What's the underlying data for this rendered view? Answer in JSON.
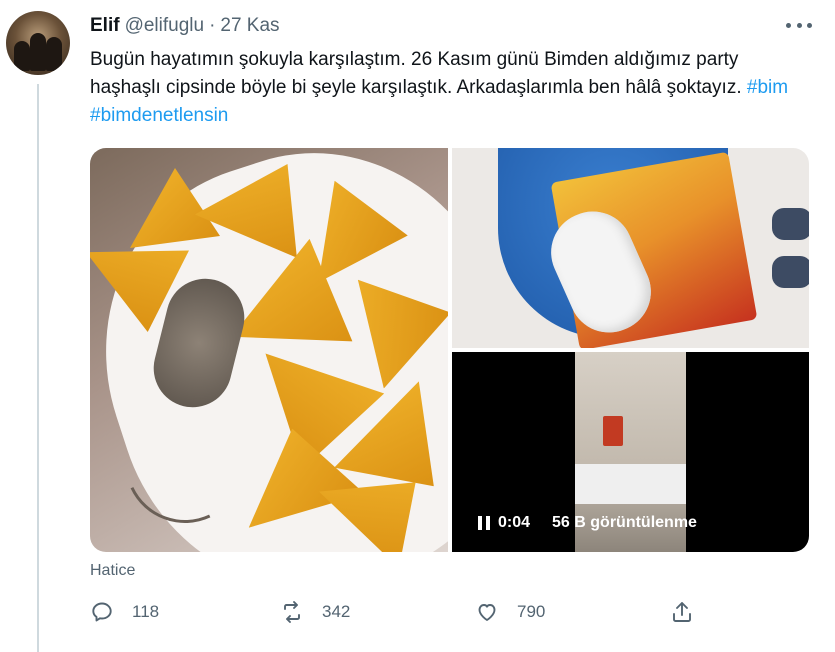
{
  "tweet": {
    "author_name": "Elif",
    "author_handle": "@elifuglu",
    "separator": "·",
    "date": "27 Kas",
    "text": "Bugün hayatımın şokuyla karşılaştım. 26 Kasım günü Bimden aldığımız party haşhaşlı cipsinde böyle bi şeyle karşılaştık. Arkadaşlarımla ben hâlâ şoktayız.",
    "hashtags": [
      "#bim",
      "#bimdenetlensin"
    ]
  },
  "media": {
    "video": {
      "duration": "0:04",
      "views": "56 B görüntülenme"
    }
  },
  "tagged_user": "Hatice",
  "actions": {
    "replies": "118",
    "retweets": "342",
    "likes": "790"
  },
  "icons": [
    "more-icon",
    "reply-icon",
    "retweet-icon",
    "like-icon",
    "share-icon",
    "pause-icon"
  ],
  "colors": {
    "text": "#0f1419",
    "secondary": "#536471",
    "accent": "#1d9bf0"
  }
}
